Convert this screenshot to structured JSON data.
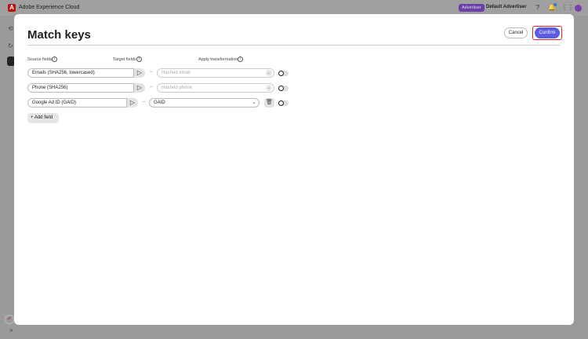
{
  "app": {
    "title": "Adobe Experience Cloud",
    "logo_letter": "A",
    "role_badge": "Advertiser",
    "account": "Default Advertiser"
  },
  "modal": {
    "title": "Match keys",
    "cancel_label": "Cancel",
    "confirm_label": "Confirm",
    "columns": {
      "source": "Source fields",
      "target": "Target fields",
      "transform": "Apply transformation"
    },
    "rows": [
      {
        "source": "Emails (SHA256, lowercased)",
        "target_placeholder": "Hashed email",
        "target_value": "",
        "transform": false
      },
      {
        "source": "Phone (SHA256)",
        "target_placeholder": "Hashed phone",
        "target_value": "",
        "transform": false
      },
      {
        "source": "Google Ad ID (GAID)",
        "target_placeholder": "",
        "target_value": "GAID",
        "transform": false
      }
    ],
    "add_field_label": "Add field",
    "separator": "–"
  },
  "colors": {
    "accent": "#5c5ce0",
    "highlight": "#e3242b",
    "badge": "#6b3fa8"
  }
}
